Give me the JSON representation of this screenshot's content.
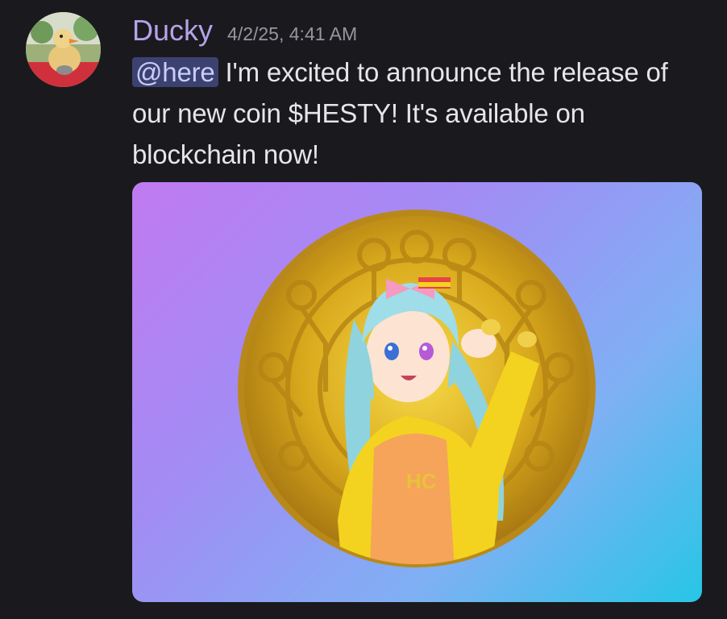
{
  "message": {
    "author": "Ducky",
    "timestamp": "4/2/25, 4:41 AM",
    "mention": "@here",
    "text": " I'm excited to announce the release of our new coin $HESTY! It's available on blockchain now!",
    "avatar_icon": "duck-avatar",
    "attachment": {
      "type": "image",
      "description_icon": "coin-artwork",
      "coin_emblem": "HC"
    }
  },
  "colors": {
    "background": "#1a1a1e",
    "author": "#b6a3e8",
    "timestamp": "#96969f",
    "text": "#e6e6ea",
    "mention_bg": "#3c4270",
    "mention_text": "#c9cdfb"
  }
}
